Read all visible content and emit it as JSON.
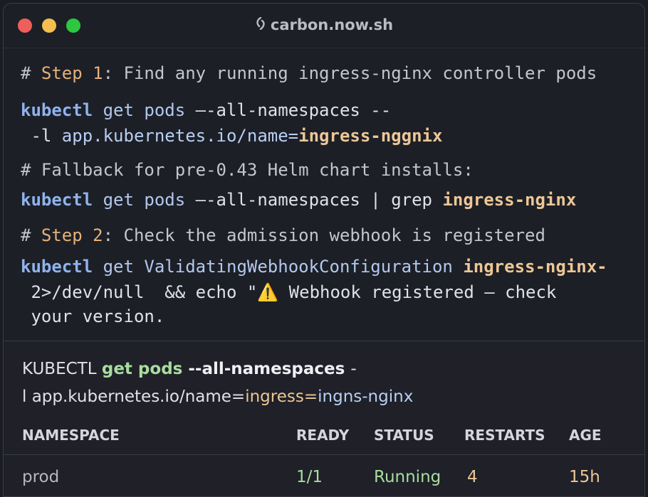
{
  "window": {
    "title": "carbon.now.sh",
    "controls": [
      "close",
      "minimize",
      "maximize"
    ],
    "title_icon": "carbon-logo-icon"
  },
  "code": {
    "line1": {
      "hash": "# ",
      "step": "Step 1",
      "rest": ": Find any running ingress-nginx controller pods"
    },
    "line2": {
      "cmd": "kubectl",
      "get": " get pods ",
      "flag": "—-all-namespaces --"
    },
    "line3": {
      "flag": " -l ",
      "path": "app.kubernetes.io/name=",
      "value": "ingress-nggnix"
    },
    "line4": {
      "text": "# Fallback for pre-0.43 Helm chart installs:"
    },
    "line5": {
      "cmd": "kubectl",
      "get": " get pods ",
      "flag": "—-all-namespaces | grep ",
      "value": "ingress-nginx"
    },
    "line6": {
      "hash": "# ",
      "step": "Step 2",
      "rest": ": Check the admission webhook is registered"
    },
    "line7": {
      "cmd": "kubectl",
      "get": " get ValidatingWebhookConfiguration ",
      "value": "ingress-nginx-"
    },
    "line8": {
      "text": " 2>/dev/null  && echo \"",
      "warn": "⚠️",
      "rest": " Webhook registered — check"
    },
    "line9": {
      "text": " your version."
    }
  },
  "output": {
    "cmd_line1": {
      "prefix": "KUBECTL ",
      "getpods": "get pods ",
      "flag": "--all-namespaces ",
      "tail": "-"
    },
    "cmd_line2": {
      "l": "l ",
      "path": "app.kubernetes.io/name=",
      "value1": "ingress",
      "eq": "=",
      "value2": "ingns-nginx"
    },
    "table": {
      "headers": [
        "NAMESPACE",
        "READY",
        "STATUS",
        "RESTARTS",
        "AGE"
      ],
      "rows": [
        {
          "namespace": "prod",
          "ready": "1/1",
          "status": "Running",
          "restarts": "4",
          "age": "15h"
        }
      ]
    }
  },
  "colors": {
    "background": "#1d1f27",
    "close": "#ee5f5b",
    "minimize": "#f4bf4f",
    "maximize": "#2bc840",
    "command": "#8fb3ec",
    "highlight": "#ecc795",
    "running": "#a9dca0"
  }
}
